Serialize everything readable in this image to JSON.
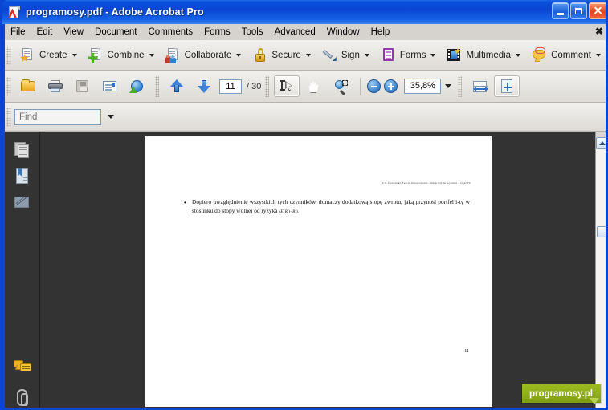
{
  "window": {
    "title": "programosy.pdf - Adobe Acrobat Pro",
    "app_icon": "pdf-document-icon",
    "buttons": {
      "minimize": "minimize",
      "maximize": "maximize",
      "close": "close"
    }
  },
  "menubar": {
    "items": [
      {
        "label": "File",
        "name": "menu-file"
      },
      {
        "label": "Edit",
        "name": "menu-edit"
      },
      {
        "label": "View",
        "name": "menu-view"
      },
      {
        "label": "Document",
        "name": "menu-document"
      },
      {
        "label": "Comments",
        "name": "menu-comments"
      },
      {
        "label": "Forms",
        "name": "menu-forms"
      },
      {
        "label": "Tools",
        "name": "menu-tools"
      },
      {
        "label": "Advanced",
        "name": "menu-advanced"
      },
      {
        "label": "Window",
        "name": "menu-window"
      },
      {
        "label": "Help",
        "name": "menu-help"
      }
    ],
    "close_document_glyph": "✖"
  },
  "toolbar_tasks": {
    "items": [
      {
        "label": "Create",
        "icon": "create-pdf-icon"
      },
      {
        "label": "Combine",
        "icon": "combine-files-icon"
      },
      {
        "label": "Collaborate",
        "icon": "collaborate-icon"
      },
      {
        "label": "Secure",
        "icon": "lock-icon"
      },
      {
        "label": "Sign",
        "icon": "pen-sign-icon"
      },
      {
        "label": "Forms",
        "icon": "forms-icon"
      },
      {
        "label": "Multimedia",
        "icon": "multimedia-icon"
      },
      {
        "label": "Comment",
        "icon": "comment-bubble-icon"
      }
    ]
  },
  "toolbar_file": {
    "open": "open-folder-icon",
    "print": "printer-icon",
    "save": "save-floppy-icon",
    "email": "email-icon",
    "upload": "upload-globe-icon",
    "prev_page": "arrow-up-icon",
    "next_page": "arrow-down-icon",
    "page_current": "11",
    "page_separator": "/",
    "page_total": "30",
    "select_tool": "select-text-icon",
    "hand_tool": "hand-tool-icon",
    "marquee_zoom": "marquee-zoom-icon",
    "zoom_out": "zoom-out-icon",
    "zoom_in": "zoom-in-icon",
    "zoom_value": "35,8%",
    "fit_width": "fit-width-icon",
    "fit_page": "fit-page-icon"
  },
  "findbar": {
    "placeholder": "Find",
    "value": "",
    "dropdown": "find-options-caret"
  },
  "navpane": {
    "items": [
      {
        "name": "nav-pages",
        "icon": "pages-panel-icon"
      },
      {
        "name": "nav-bookmarks",
        "icon": "bookmarks-panel-icon"
      },
      {
        "name": "nav-signatures",
        "icon": "signatures-panel-icon"
      },
      {
        "name": "nav-comments",
        "icon": "comments-panel-icon"
      },
      {
        "name": "nav-attachments",
        "icon": "attachments-panel-icon"
      }
    ]
  },
  "document": {
    "header": "dr J. Żarnowski, Teoria Inwestowania - materiały do wykładu - część IV",
    "bullet": "•",
    "paragraph": "Dopiero uwzględnienie wszystkich tych czynników, tłumaczy dodatkową stopę zwrotu, jaką przynosi portfel i-ty w stosunku do stopy wolnej od ryzyka",
    "formula_open": "(",
    "formula_e": "E",
    "formula_r_open": "(",
    "formula_ri": "R",
    "formula_ri_sub": "i",
    "formula_r_close": ")",
    "formula_minus": "−",
    "formula_rf": "R",
    "formula_rf_sub": "f",
    "formula_close": ").",
    "page_number": "11"
  },
  "scrollbar": {
    "up_arrow": "scroll-up-icon",
    "thumb": "scroll-thumb"
  },
  "watermark": {
    "text": "programosy.pl"
  },
  "colors": {
    "titlebar_blue": "#0a46d2",
    "menubar_gray": "#d6d3ce",
    "toolbar_gray": "#e6e4e0",
    "workspace_dark": "#333333",
    "watermark_green": "#8fae1a",
    "page_white": "#ffffff"
  }
}
